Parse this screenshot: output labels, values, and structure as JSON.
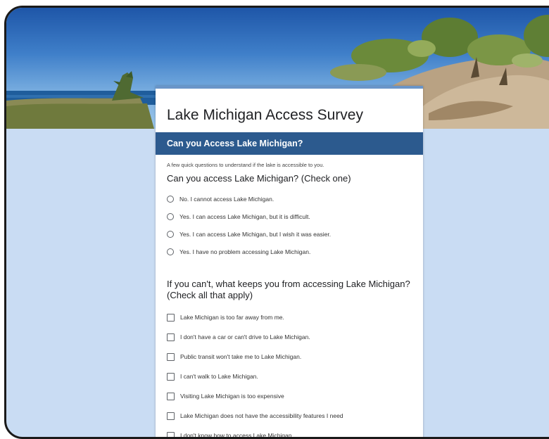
{
  "form": {
    "title": "Lake Michigan Access Survey",
    "section_title": "Can you Access Lake Michigan?",
    "description": "A few quick questions to understand if the lake is accessible to you.",
    "accent_color": "#2c5a8e",
    "page_bg": "#c9dcf3"
  },
  "questions": [
    {
      "title": "Can you access Lake Michigan? (Check one)",
      "type": "radio",
      "options": [
        "No. I cannot access Lake Michigan.",
        "Yes. I can access Lake Michigan, but it is difficult.",
        "Yes. I can access Lake Michigan, but I wish it was easier.",
        "Yes. I have no problem accessing Lake Michigan."
      ]
    },
    {
      "title": "If you can't, what keeps you from accessing Lake Michigan? (Check all that apply)",
      "type": "checkbox",
      "options": [
        "Lake Michigan is too far away from me.",
        "I don't have a car or can't drive to Lake Michigan.",
        "Public transit won't take me to Lake Michigan.",
        "I can't walk to Lake Michigan.",
        "Visiting Lake Michigan is too expensive",
        "Lake Michigan does not have the accessibility features I need",
        "I don't know how to access Lake Michigan"
      ]
    }
  ]
}
